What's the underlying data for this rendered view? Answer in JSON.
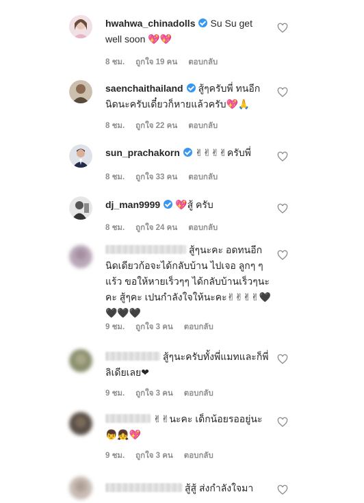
{
  "comments": [
    {
      "username": "hwahwa_chinadolls",
      "verified": true,
      "text": "Su Su get well soon 💖💖",
      "time": "8 ชม.",
      "likes": "ถูกใจ 19 คน",
      "reply": "ตอบกลับ",
      "avatar_color": "#e8b4c8"
    },
    {
      "username": "saenchaithailand",
      "verified": true,
      "text": "สู้ๆครับพี่ ทนอีกนิดนะครับเดี๋ยวก็หายแล้วครับ💖🙏",
      "time": "8 ชม.",
      "likes": "ถูกใจ 22 คน",
      "reply": "ตอบกลับ",
      "avatar_color": "#6b5a48"
    },
    {
      "username": "sun_prachakorn",
      "verified": true,
      "text": "✌✌✌✌ครับพี่",
      "time": "8 ชม.",
      "likes": "ถูกใจ 33 คน",
      "reply": "ตอบกลับ",
      "avatar_color": "#2a3a5a"
    },
    {
      "username": "dj_man9999",
      "verified": true,
      "text": "💖สู้ ครับ",
      "time": "8 ชม.",
      "likes": "ถูกใจ 24 คน",
      "reply": "ตอบกลับ",
      "avatar_color": "#4a4a4a"
    },
    {
      "username": "",
      "verified": false,
      "text": "สู้ๆนะคะ อดทนอีกนิดเดียวก้อจะได้กลับบ้าน ไปเจอ ลูกๆ ๆแร้ว ขอให้หายเร็วๆๆ ได้กลับบ้านเร็วๆนะคะ สู้ๆคะ เปนกำลังใจให้นะคะ✌✌✌✌🖤🖤🖤🖤",
      "time": "9 ชม.",
      "likes": "ถูกใจ 3 คน",
      "reply": "ตอบกลับ",
      "avatar_color": "#b9a8b8"
    },
    {
      "username": "",
      "verified": false,
      "text": "สู้ๆนะครับทั้งพี่แมทและก็พี่ลิเดียเลย❤",
      "time": "9 ชม.",
      "likes": "ถูกใจ 3 คน",
      "reply": "ตอบกลับ",
      "avatar_color": "#8c9070"
    },
    {
      "username": "",
      "verified": false,
      "text": "✌✌นะคะ เด็กน้อยรออยู่นะ👦👧💖",
      "time": "9 ชม.",
      "likes": "ถูกใจ 3 คน",
      "reply": "ตอบกลับ",
      "avatar_color": "#5a5048"
    },
    {
      "username": "",
      "verified": false,
      "text": "สู้สู้ ส่งกำลังใจมา",
      "time": "",
      "likes": "",
      "reply": "",
      "avatar_color": "#c8bcb4"
    }
  ]
}
